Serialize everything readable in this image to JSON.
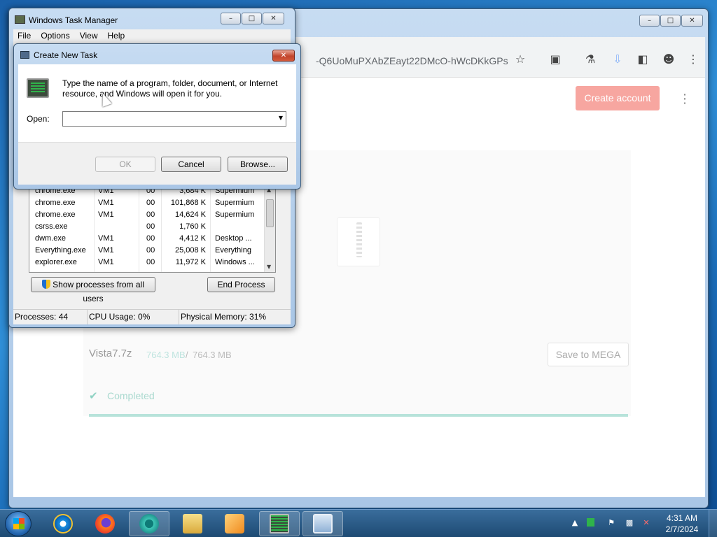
{
  "browser": {
    "url_fragment": "-Q6UoMuPXAbZEayt22DMcO-hWcDKkGPs",
    "create_account": "Create account",
    "file": {
      "name": "Vista7.7z",
      "downloaded": "764.3 MB",
      "separator": "/",
      "total": "764.3 MB",
      "save_button": "Save to MEGA",
      "status": "Completed",
      "progress_percent": 100
    }
  },
  "task_manager": {
    "title": "Windows Task Manager",
    "menu": [
      "File",
      "Options",
      "View",
      "Help"
    ],
    "processes": [
      {
        "name": "chrome.exe",
        "user": "VM1",
        "cpu": "00",
        "mem": "3,684 K",
        "desc": "Supermium"
      },
      {
        "name": "chrome.exe",
        "user": "VM1",
        "cpu": "00",
        "mem": "101,868 K",
        "desc": "Supermium"
      },
      {
        "name": "chrome.exe",
        "user": "VM1",
        "cpu": "00",
        "mem": "14,624 K",
        "desc": "Supermium"
      },
      {
        "name": "csrss.exe",
        "user": "",
        "cpu": "00",
        "mem": "1,760 K",
        "desc": ""
      },
      {
        "name": "dwm.exe",
        "user": "VM1",
        "cpu": "00",
        "mem": "4,412 K",
        "desc": "Desktop ..."
      },
      {
        "name": "Everything.exe",
        "user": "VM1",
        "cpu": "00",
        "mem": "25,008 K",
        "desc": "Everything"
      },
      {
        "name": "explorer.exe",
        "user": "VM1",
        "cpu": "00",
        "mem": "11,972 K",
        "desc": "Windows ..."
      }
    ],
    "show_all_button": "Show processes from all users",
    "end_process_button": "End Process",
    "status": {
      "processes": "Processes: 44",
      "cpu": "CPU Usage: 0%",
      "memory": "Physical Memory: 31%"
    }
  },
  "run_dialog": {
    "title": "Create New Task",
    "description": "Type the name of a program, folder, document, or Internet resource, and Windows will open it for you.",
    "open_label": "Open:",
    "open_value": "",
    "ok": "OK",
    "cancel": "Cancel",
    "browse": "Browse..."
  },
  "taskbar": {
    "apps": [
      "start-orb-icon",
      "internet-explorer-icon",
      "firefox-icon",
      "chromium-browser-icon",
      "file-explorer-icon",
      "media-player-icon",
      "task-manager-icon",
      "run-dialog-icon"
    ],
    "time": "4:31 AM",
    "date": "2/7/2024"
  },
  "colors": {
    "accent_mega": "#f7a6a0",
    "completed": "#aad9cf"
  }
}
